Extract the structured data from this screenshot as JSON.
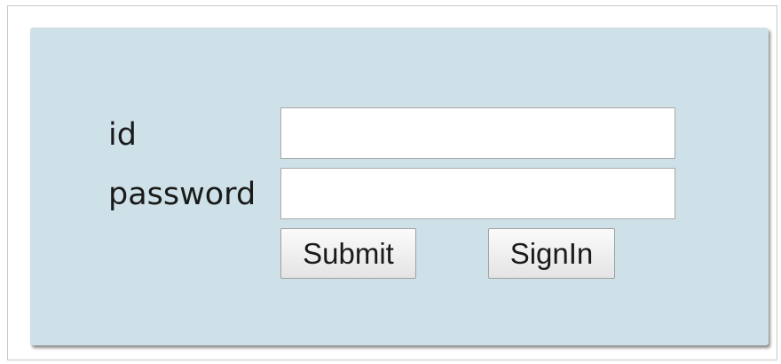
{
  "form": {
    "id_label": "id",
    "password_label": "password",
    "id_value": "",
    "password_value": "",
    "submit_label": "Submit",
    "signin_label": "SignIn"
  },
  "colors": {
    "panel_background": "#cfe1e8",
    "page_background": "#ffffff"
  }
}
